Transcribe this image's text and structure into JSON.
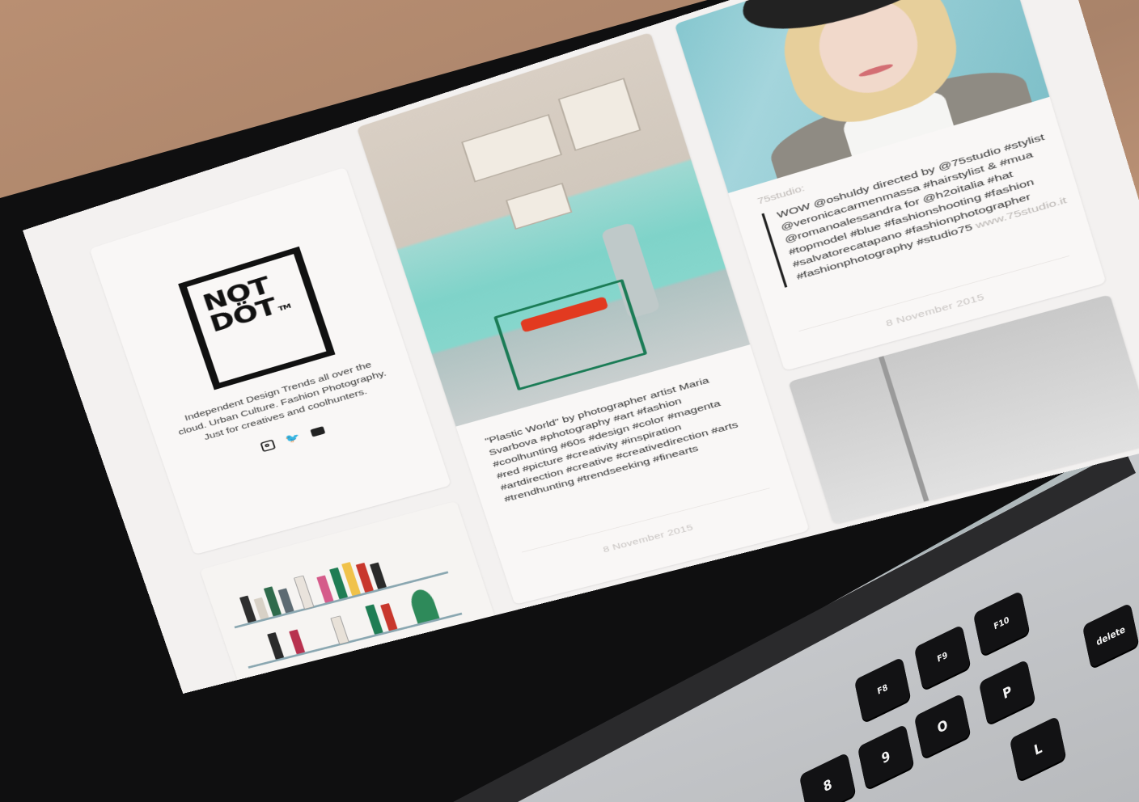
{
  "brand": {
    "logo_line1": "NOT",
    "logo_line2": "DÖT",
    "logo_tm": "TM",
    "tagline": "Independent Design Trends all over the cloud. Urban Culture. Fashion Photography. Just for creatives and coolhunters.",
    "social_icons": [
      "instagram-icon",
      "twitter-icon",
      "youtube-icon"
    ]
  },
  "posts": [
    {
      "caption": "\"Plastic World\" by photographer artist Maria Svarbova #photography #art #fashion #coolhunting #60s #design #color #magenta #red #picture #creativity #inspiration #artdirection #creative #creativedirection #arts #trendhunting #trendseeking #finearts",
      "date": "8 November 2015"
    },
    {
      "source": "75studio:",
      "quote": "WOW @oshuldy directed by @75studio #stylist @veronicacarmenmassa #hairstylist & #mua @romanoalessandra for @h2oitalia #hat #topmodel #blue #fashionshooting #fashion #salvatorecatapano #fashionphotographer #fashionphotography #studio75",
      "link": "www.75studio.it",
      "date": "8 November 2015"
    }
  ],
  "keyboard": {
    "keys": [
      "delete",
      "P",
      "O",
      "L",
      "9",
      "8",
      "F10",
      "F9",
      "F8"
    ]
  },
  "colors": {
    "accent": "#1b7c56",
    "text": "#333333",
    "muted": "#c8c4c2",
    "bezel": "#0f0f10"
  }
}
